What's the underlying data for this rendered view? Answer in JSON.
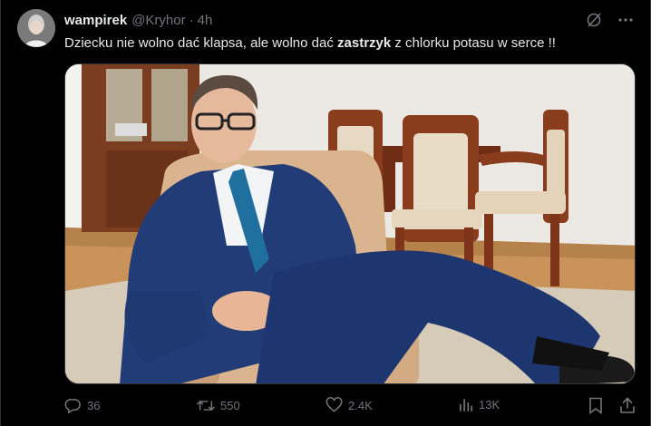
{
  "post": {
    "display_name": "wampirek",
    "handle": "@Kryhor",
    "separator": "·",
    "time": "4h",
    "text_before": "Dziecku nie wolno dać klapsa, ale wolno dać ",
    "text_bold": "zastrzyk",
    "text_after": " z chlorku potasu w serce !!",
    "icons": {
      "grok": "grok-slash-circle-icon",
      "more": "more-dots-icon"
    }
  },
  "actions": {
    "replies": "36",
    "reposts": "550",
    "likes": "2.4K",
    "views": "13K",
    "icons": [
      "reply-icon",
      "repost-icon",
      "like-icon",
      "views-icon",
      "bookmark-icon",
      "share-icon"
    ]
  },
  "colors": {
    "background": "#000000",
    "text_primary": "#e7e9ea",
    "text_secondary": "#71767b",
    "border": "#2f3336"
  }
}
